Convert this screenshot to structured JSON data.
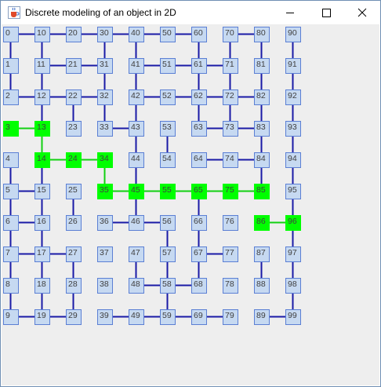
{
  "window": {
    "title": "Discrete modeling of an object in 2D",
    "icon": "java-cup-icon",
    "controls": [
      "minimize",
      "maximize",
      "close"
    ]
  },
  "colors": {
    "node_fill": "#c6d9f1",
    "node_border": "#5b7fd4",
    "node_text": "#404040",
    "edge": "#1a1aa6",
    "highlight_fill": "#00ff00",
    "highlight_edge": "#11d011",
    "background": "#eeeeee"
  },
  "grid": {
    "columns": 10,
    "rows": 10
  },
  "nodes": [
    "0",
    "1",
    "2",
    "3",
    "4",
    "5",
    "6",
    "7",
    "8",
    "9",
    "10",
    "11",
    "12",
    "13",
    "14",
    "15",
    "16",
    "17",
    "18",
    "19",
    "20",
    "21",
    "22",
    "23",
    "24",
    "25",
    "26",
    "27",
    "28",
    "29",
    "30",
    "31",
    "32",
    "33",
    "34",
    "35",
    "36",
    "37",
    "38",
    "39",
    "40",
    "41",
    "42",
    "43",
    "44",
    "45",
    "46",
    "47",
    "48",
    "49",
    "50",
    "51",
    "52",
    "53",
    "54",
    "55",
    "56",
    "57",
    "58",
    "59",
    "60",
    "61",
    "62",
    "63",
    "64",
    "65",
    "66",
    "67",
    "68",
    "69",
    "70",
    "71",
    "72",
    "73",
    "74",
    "75",
    "76",
    "77",
    "78",
    "79",
    "80",
    "81",
    "82",
    "83",
    "84",
    "85",
    "86",
    "87",
    "88",
    "89",
    "90",
    "91",
    "92",
    "93",
    "94",
    "95",
    "96",
    "97",
    "98",
    "99"
  ],
  "highlighted": [
    3,
    13,
    14,
    24,
    34,
    35,
    45,
    55,
    65,
    75,
    85,
    86,
    96
  ],
  "edges": [
    [
      0,
      10
    ],
    [
      10,
      20
    ],
    [
      20,
      30
    ],
    [
      30,
      40
    ],
    [
      40,
      50
    ],
    [
      50,
      60
    ],
    [
      70,
      80
    ],
    [
      11,
      21
    ],
    [
      21,
      31
    ],
    [
      41,
      51
    ],
    [
      51,
      61
    ],
    [
      61,
      71
    ],
    [
      2,
      12
    ],
    [
      12,
      22
    ],
    [
      22,
      32
    ],
    [
      42,
      52
    ],
    [
      52,
      62
    ],
    [
      62,
      72
    ],
    [
      72,
      82
    ],
    [
      3,
      13
    ],
    [
      33,
      43
    ],
    [
      63,
      73
    ],
    [
      73,
      83
    ],
    [
      14,
      24
    ],
    [
      24,
      34
    ],
    [
      64,
      74
    ],
    [
      74,
      84
    ],
    [
      5,
      15
    ],
    [
      35,
      45
    ],
    [
      45,
      55
    ],
    [
      55,
      65
    ],
    [
      65,
      75
    ],
    [
      75,
      85
    ],
    [
      6,
      16
    ],
    [
      36,
      46
    ],
    [
      46,
      56
    ],
    [
      86,
      96
    ],
    [
      7,
      17
    ],
    [
      17,
      27
    ],
    [
      67,
      77
    ],
    [
      48,
      58
    ],
    [
      58,
      68
    ],
    [
      9,
      19
    ],
    [
      19,
      29
    ],
    [
      39,
      49
    ],
    [
      49,
      59
    ],
    [
      59,
      69
    ],
    [
      69,
      79
    ],
    [
      89,
      99
    ],
    [
      0,
      1
    ],
    [
      1,
      2
    ],
    [
      4,
      5
    ],
    [
      5,
      6
    ],
    [
      6,
      7
    ],
    [
      7,
      8
    ],
    [
      8,
      9
    ],
    [
      10,
      11
    ],
    [
      11,
      12
    ],
    [
      12,
      13
    ],
    [
      13,
      14
    ],
    [
      14,
      15
    ],
    [
      15,
      16
    ],
    [
      16,
      17
    ],
    [
      17,
      18
    ],
    [
      18,
      19
    ],
    [
      22,
      23
    ],
    [
      25,
      26
    ],
    [
      27,
      28
    ],
    [
      28,
      29
    ],
    [
      30,
      31
    ],
    [
      31,
      32
    ],
    [
      32,
      33
    ],
    [
      34,
      35
    ],
    [
      40,
      41
    ],
    [
      41,
      42
    ],
    [
      42,
      43
    ],
    [
      43,
      44
    ],
    [
      44,
      45
    ],
    [
      45,
      46
    ],
    [
      47,
      48
    ],
    [
      53,
      54
    ],
    [
      56,
      57
    ],
    [
      57,
      58
    ],
    [
      58,
      59
    ],
    [
      60,
      61
    ],
    [
      61,
      62
    ],
    [
      62,
      63
    ],
    [
      65,
      66
    ],
    [
      66,
      67
    ],
    [
      67,
      68
    ],
    [
      70,
      71
    ],
    [
      71,
      72
    ],
    [
      72,
      73
    ],
    [
      80,
      81
    ],
    [
      81,
      82
    ],
    [
      82,
      83
    ],
    [
      83,
      84
    ],
    [
      84,
      85
    ],
    [
      87,
      88
    ],
    [
      90,
      91
    ],
    [
      91,
      92
    ],
    [
      92,
      93
    ],
    [
      93,
      94
    ],
    [
      94,
      95
    ],
    [
      95,
      96
    ],
    [
      96,
      97
    ],
    [
      97,
      98
    ],
    [
      98,
      99
    ]
  ]
}
